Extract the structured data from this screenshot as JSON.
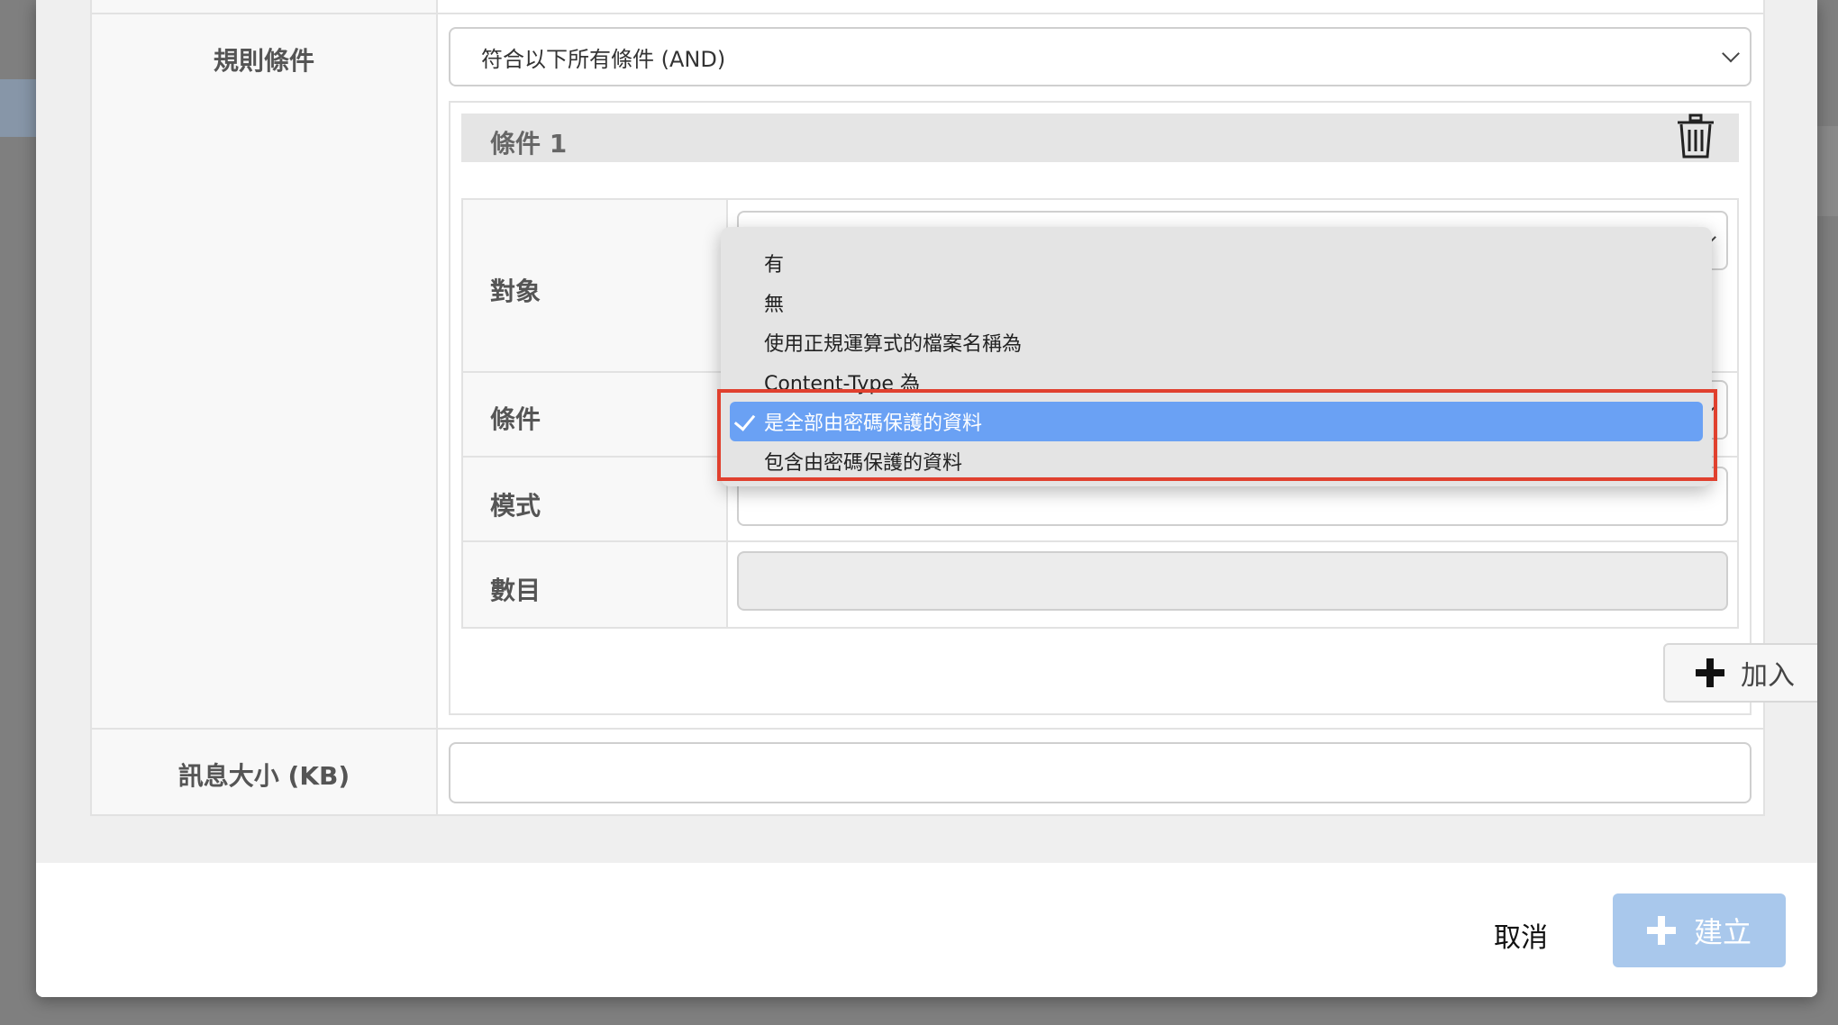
{
  "form": {
    "rule_conditions_label": "規則條件",
    "match_mode_selected": "符合以下所有條件 (AND)",
    "condition_title": "條件 1",
    "rows": {
      "target_label": "對象",
      "condition_label": "條件",
      "pattern_label": "模式",
      "count_label": "數目"
    },
    "add_button_label": "加入",
    "message_size_label": "訊息大小 (KB)",
    "message_size_value": ""
  },
  "dropdown": {
    "options": [
      "有",
      "無",
      "使用正規運算式的檔案名稱為",
      "Content-Type 為",
      "是全部由密碼保護的資料",
      "包含由密碼保護的資料"
    ],
    "selected": "是全部由密碼保護的資料"
  },
  "footer": {
    "cancel_label": "取消",
    "create_label": "建立"
  },
  "icons": {
    "trash": "trash-icon",
    "plus": "plus-icon",
    "chevron": "chevron-down-icon",
    "check": "check-icon"
  },
  "colors": {
    "selected_option": "#6aa1f4",
    "highlight_border": "#e0402e",
    "create_button": "#a9c8ec"
  }
}
